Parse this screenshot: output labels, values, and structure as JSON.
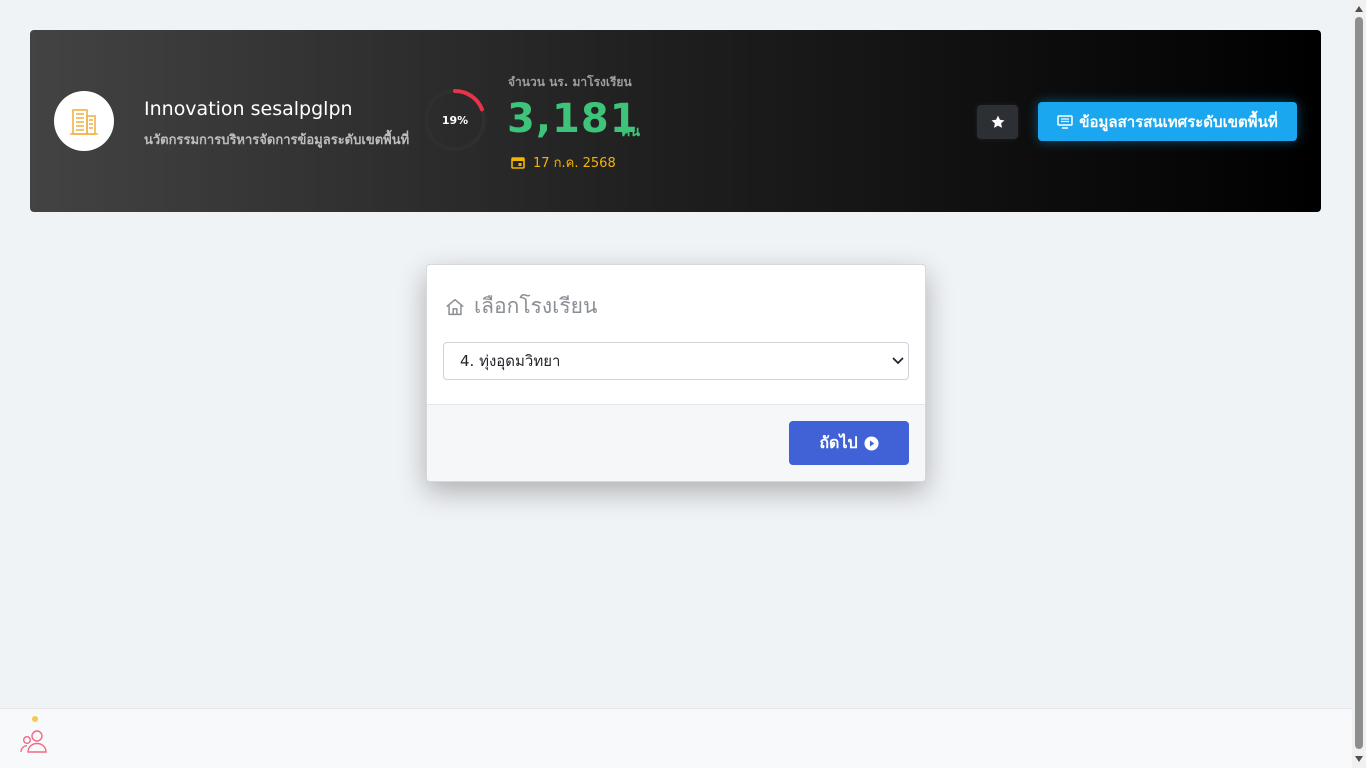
{
  "header": {
    "brand_name": "Innovation sesalpglpn",
    "brand_subtitle": "นวัตกรรมการบริหารจัดการข้อมูลระดับเขตพื้นที่",
    "gauge_percent": 19,
    "gauge_label": "19%",
    "student_count_label": "จำนวน นร. มาโรงเรียน",
    "student_count": "3,181",
    "student_unit": "คน",
    "date": "17 ก.ค. 2568",
    "info_button_label": "ข้อมูลสารสนเทศระดับเขตพื้นที่",
    "colors": {
      "accent_green": "#3ec47a",
      "date_yellow": "#f4b400",
      "gauge_red": "#e8334a",
      "info_blue": "#1ba7f0"
    },
    "icons": [
      "building-logo-icon",
      "calendar-icon",
      "star-icon",
      "monitor-icon"
    ]
  },
  "school_modal": {
    "title": "เลือกโรงเรียน",
    "selected_school": "4. ทุ่งอุดมวิทยา",
    "next_button_label": "ถัดไป",
    "colors": {
      "next_button": "#4062d6"
    },
    "icons": [
      "home-icon",
      "chevron-down-icon",
      "play-circle-icon"
    ]
  },
  "bottom_bar": {
    "icons": [
      "users-icon"
    ],
    "colors": {
      "users_icon": "#f06a86",
      "notification_dot": "#f5c94e"
    }
  }
}
